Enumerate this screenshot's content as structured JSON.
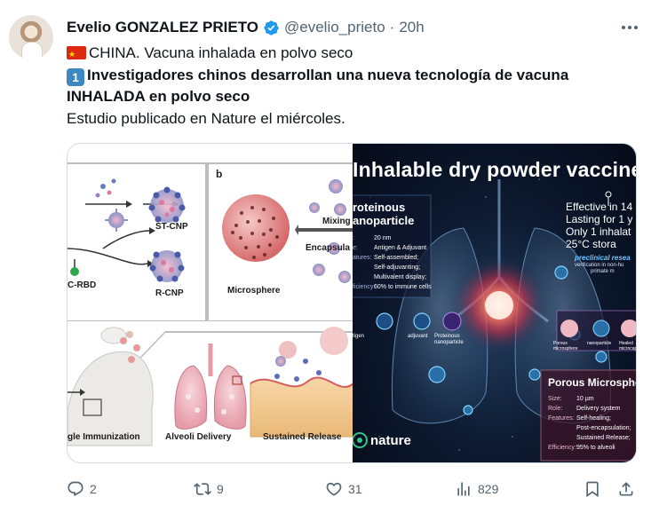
{
  "author": {
    "name": "Evelio GONZALEZ PRIETO",
    "handle": "@evelio_prieto",
    "separator": "·",
    "time": "20h"
  },
  "tweet": {
    "line1": "CHINA. Vacuna inhalada en polvo seco",
    "keycap": "1",
    "line2": "Investigadores chinos desarrollan una nueva tecnología de vacuna",
    "line3": "INHALADA en polvo seco",
    "line4": "Estudio publicado en Nature el miércoles."
  },
  "left_image": {
    "panel_b_label": "b",
    "st_cnp": "ST-CNP",
    "r_cnp": "R-CNP",
    "c_rbd": "C-RBD",
    "microsphere": "Microsphere",
    "mixing": "Mixing",
    "encapsula": "Encapsula",
    "immunization": "gle Immunization",
    "alveoli": "Alveoli Delivery",
    "sustained": "Sustained Release"
  },
  "right_image": {
    "title": "Inhalable dry powder vaccine",
    "effects": [
      "Effective in 14 da",
      "Lasting for 1 y",
      "Only 1 inhalat",
      "25°C stora"
    ],
    "preclinical": "preclinical resea",
    "preclinical_sub": "verification in non-hu",
    "preclinical_sub2": "primate m",
    "proteinous_title1": "roteinous",
    "proteinous_title2": "anoparticle",
    "nano_rows": [
      {
        "key": ":",
        "val": "20 nm"
      },
      {
        "key": "e:",
        "val": "Antigen & Adjuvant"
      },
      {
        "key": "atures:",
        "val": "Self-assembled;"
      },
      {
        "key": "",
        "val": "Self-adjuvanting;"
      },
      {
        "key": "",
        "val": "Multivalent display;"
      },
      {
        "key": "ficiency:",
        "val": "60% to immune cells"
      }
    ],
    "eq_labels": [
      "tigen",
      "adjuvant",
      "Proteinous nanoparticle"
    ],
    "micro_labels": [
      "Porous microsphere",
      "nanoparticle",
      "Healed microcap"
    ],
    "porous_title": "Porous Microsphere",
    "porous_rows": [
      {
        "key": "Size:",
        "val": "10 µm"
      },
      {
        "key": "Role:",
        "val": "Delivery system"
      },
      {
        "key": "Features:",
        "val": "Self-healing;"
      },
      {
        "key": "",
        "val": "Post-encapsulation;"
      },
      {
        "key": "",
        "val": "Sustained Release;"
      },
      {
        "key": "Efficiency:",
        "val": "95% to alveoli"
      }
    ],
    "nature": "nature"
  },
  "actions": {
    "replies": "2",
    "reposts": "9",
    "likes": "31",
    "views": "829"
  },
  "colors": {
    "text": "#0f1419",
    "muted": "#536471",
    "verified": "#1d9bf0"
  }
}
